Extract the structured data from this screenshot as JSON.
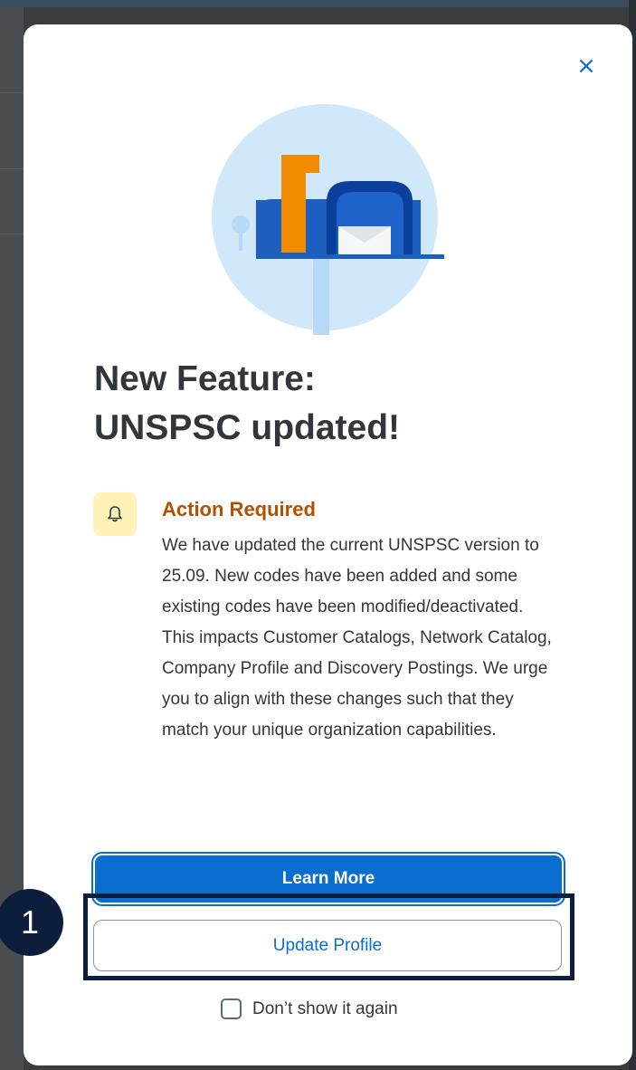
{
  "dialog": {
    "close_label": "×",
    "title_line1": "New Feature:",
    "title_line2": "UNSPSC updated!",
    "notice": {
      "icon": "bell-icon",
      "heading": "Action Required",
      "body": "We have updated the current UNSPSC version to 25.09. New codes have been added and some existing codes have been modified/deactivated. This impacts Customer Catalogs, Network Catalog, Company Profile and Discovery Postings. We urge you to align with these changes such that they match your unique organization capabilities."
    },
    "learn_more_label": "Learn More",
    "update_profile_label": "Update Profile",
    "dont_show_label": "Don’t show it again"
  },
  "annotation": {
    "step_number": "1"
  },
  "colors": {
    "accent": "#0a6ed1",
    "warning_text": "#b44f00",
    "warning_bg": "#fff3b8",
    "annotation": "#0c1e3c"
  }
}
